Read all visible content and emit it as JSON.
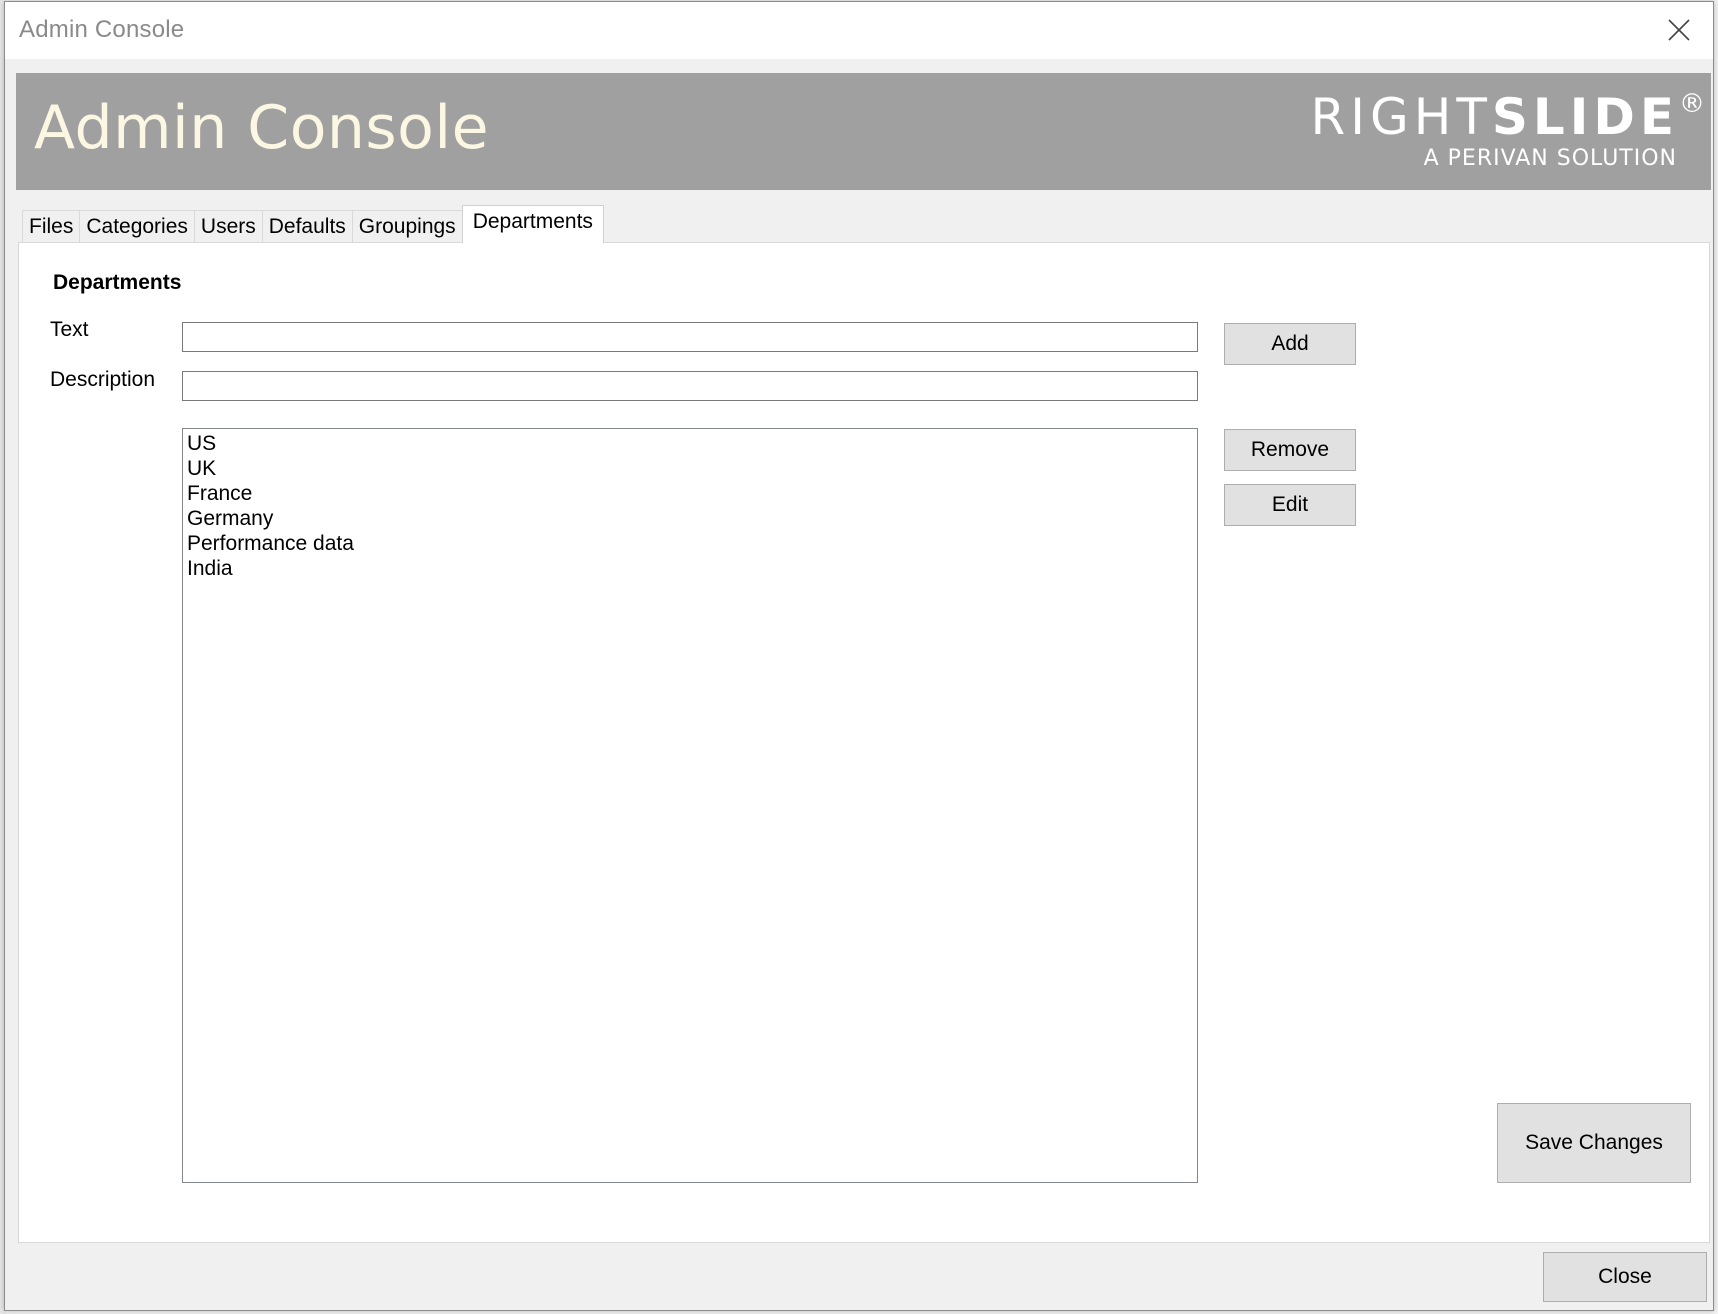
{
  "window": {
    "title": "Admin Console"
  },
  "banner": {
    "title": "Admin Console",
    "brand_thin": "RIGHT",
    "brand_bold": "SLIDE",
    "brand_mark": "®",
    "brand_tagline": "A PERIVAN SOLUTION"
  },
  "tabs": [
    {
      "label": "Files",
      "active": false
    },
    {
      "label": "Categories",
      "active": false
    },
    {
      "label": "Users",
      "active": false
    },
    {
      "label": "Defaults",
      "active": false
    },
    {
      "label": "Groupings",
      "active": false
    },
    {
      "label": "Departments",
      "active": true
    }
  ],
  "departments": {
    "heading": "Departments",
    "text_label": "Text",
    "text_value": "",
    "description_label": "Description",
    "description_value": "",
    "add_label": "Add",
    "remove_label": "Remove",
    "edit_label": "Edit",
    "items": [
      "US",
      "UK",
      "France",
      "Germany",
      "Performance data",
      "India"
    ]
  },
  "footer": {
    "save_label": "Save Changes",
    "close_label": "Close"
  },
  "icons": {
    "close": "close-icon"
  },
  "colors": {
    "banner_bg": "#a0a0a0",
    "banner_title": "#fbf7e3",
    "button_bg": "#e1e1e1"
  }
}
